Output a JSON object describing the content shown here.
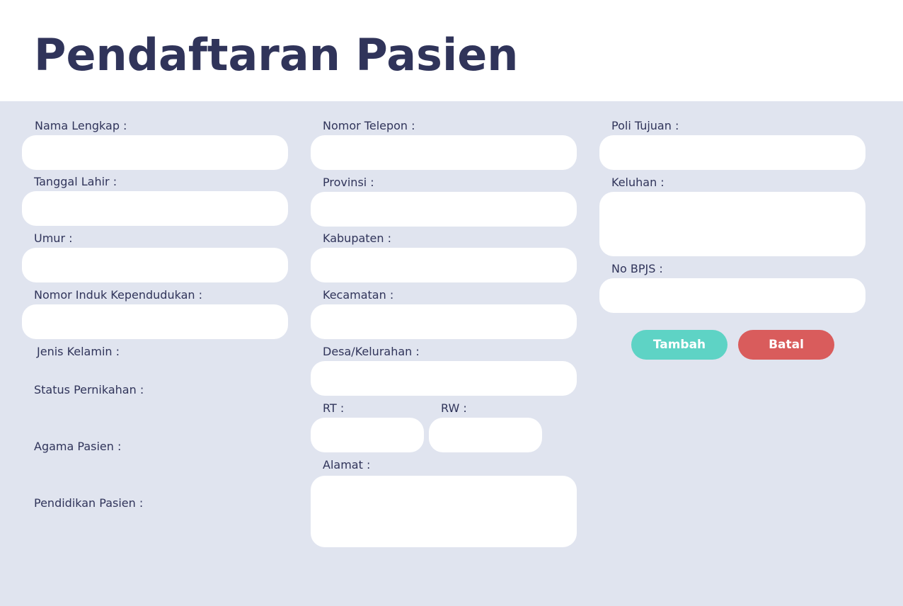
{
  "page": {
    "title": "Pendaftaran Pasien"
  },
  "colors": {
    "title": "#30345a",
    "form_background": "#e0e4ef",
    "field_background": "#ffffff",
    "add_button": "#5ed3c5",
    "cancel_button": "#d95c5c"
  },
  "form": {
    "left": {
      "nama_lengkap": {
        "label": "Nama Lengkap :",
        "value": ""
      },
      "tanggal_lahir": {
        "label": "Tanggal Lahir :",
        "value": ""
      },
      "umur": {
        "label": "Umur :",
        "value": ""
      },
      "nik": {
        "label": "Nomor Induk Kependudukan :",
        "value": ""
      },
      "jenis_kelamin": {
        "label": "Jenis Kelamin :"
      },
      "status_pernikahan": {
        "label": "Status Pernikahan :"
      },
      "agama": {
        "label": "Agama Pasien :"
      },
      "pendidikan": {
        "label": "Pendidikan Pasien :"
      }
    },
    "middle": {
      "nomor_telepon": {
        "label": "Nomor Telepon :",
        "value": ""
      },
      "provinsi": {
        "label": "Provinsi :",
        "value": ""
      },
      "kabupaten": {
        "label": "Kabupaten :",
        "value": ""
      },
      "kecamatan": {
        "label": "Kecamatan :",
        "value": ""
      },
      "desa": {
        "label": "Desa/Kelurahan :",
        "value": ""
      },
      "rt": {
        "label": "RT :",
        "value": ""
      },
      "rw": {
        "label": "RW :",
        "value": ""
      },
      "alamat": {
        "label": "Alamat :",
        "value": ""
      }
    },
    "right": {
      "poli_tujuan": {
        "label": "Poli Tujuan :",
        "value": ""
      },
      "keluhan": {
        "label": "Keluhan :",
        "value": ""
      },
      "no_bpjs": {
        "label": "No BPJS :",
        "value": ""
      }
    },
    "buttons": {
      "add_label": "Tambah",
      "cancel_label": "Batal"
    }
  }
}
